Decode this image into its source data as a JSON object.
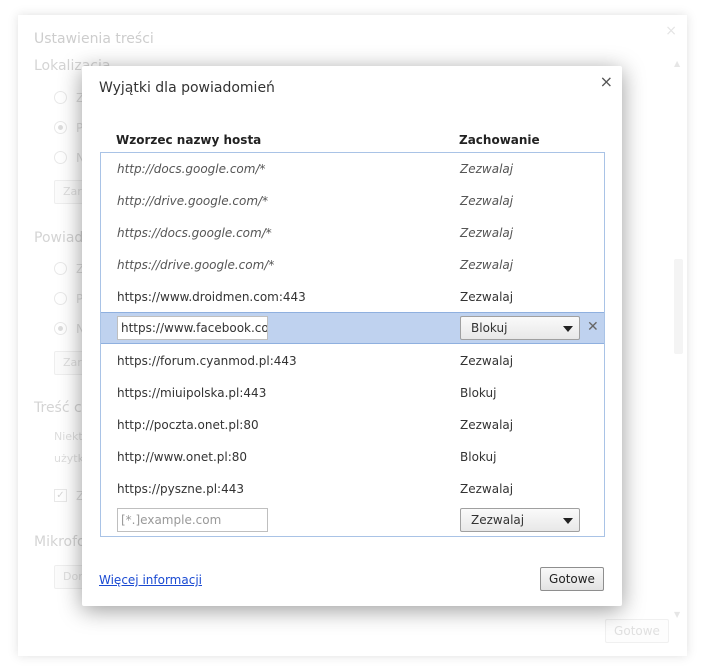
{
  "background": {
    "title": "Ustawienia treści",
    "close_glyph": "×",
    "sections": [
      {
        "label": "Lokalizacja"
      },
      {
        "label": "Powiadomienia"
      },
      {
        "label": "Treść chroniona"
      },
      {
        "label": "Mikrofon"
      }
    ],
    "section1": {
      "radios": [
        "Z",
        "P",
        "N"
      ],
      "button": "Zarządzaj"
    },
    "section2": {
      "radios": [
        "Z",
        "P",
        "N"
      ],
      "button": "Zarządzaj"
    },
    "section3": {
      "text1": "Niektó",
      "text2": "użytk",
      "checkbox_label": "Ze"
    },
    "section4": {
      "button": "Domyślne"
    },
    "done_label": "Gotowe"
  },
  "dialog": {
    "title": "Wyjątki dla powiadomień",
    "close_glyph": "×",
    "columns": {
      "pattern": "Wzorzec nazwy hosta",
      "behavior": "Zachowanie"
    },
    "rows": [
      {
        "pattern": "http://docs.google.com/*",
        "behavior": "Zezwalaj"
      },
      {
        "pattern": "http://drive.google.com/*",
        "behavior": "Zezwalaj"
      },
      {
        "pattern": "https://docs.google.com/*",
        "behavior": "Zezwalaj"
      },
      {
        "pattern": "https://drive.google.com/*",
        "behavior": "Zezwalaj"
      },
      {
        "pattern": "https://www.droidmen.com:443",
        "behavior": "Zezwalaj"
      },
      {
        "pattern": "https://www.facebook.com",
        "behavior": "Blokuj"
      },
      {
        "pattern": "https://forum.cyanmod.pl:443",
        "behavior": "Zezwalaj"
      },
      {
        "pattern": "https://miuipolska.pl:443",
        "behavior": "Blokuj"
      },
      {
        "pattern": "http://poczta.onet.pl:80",
        "behavior": "Zezwalaj"
      },
      {
        "pattern": "http://www.onet.pl:80",
        "behavior": "Blokuj"
      },
      {
        "pattern": "https://pyszne.pl:443",
        "behavior": "Zezwalaj"
      }
    ],
    "delete_glyph": "✕",
    "new_row": {
      "placeholder": "[*.]example.com",
      "behavior": "Zezwalaj"
    },
    "more_info": "Więcej informacji",
    "done": "Gotowe"
  }
}
